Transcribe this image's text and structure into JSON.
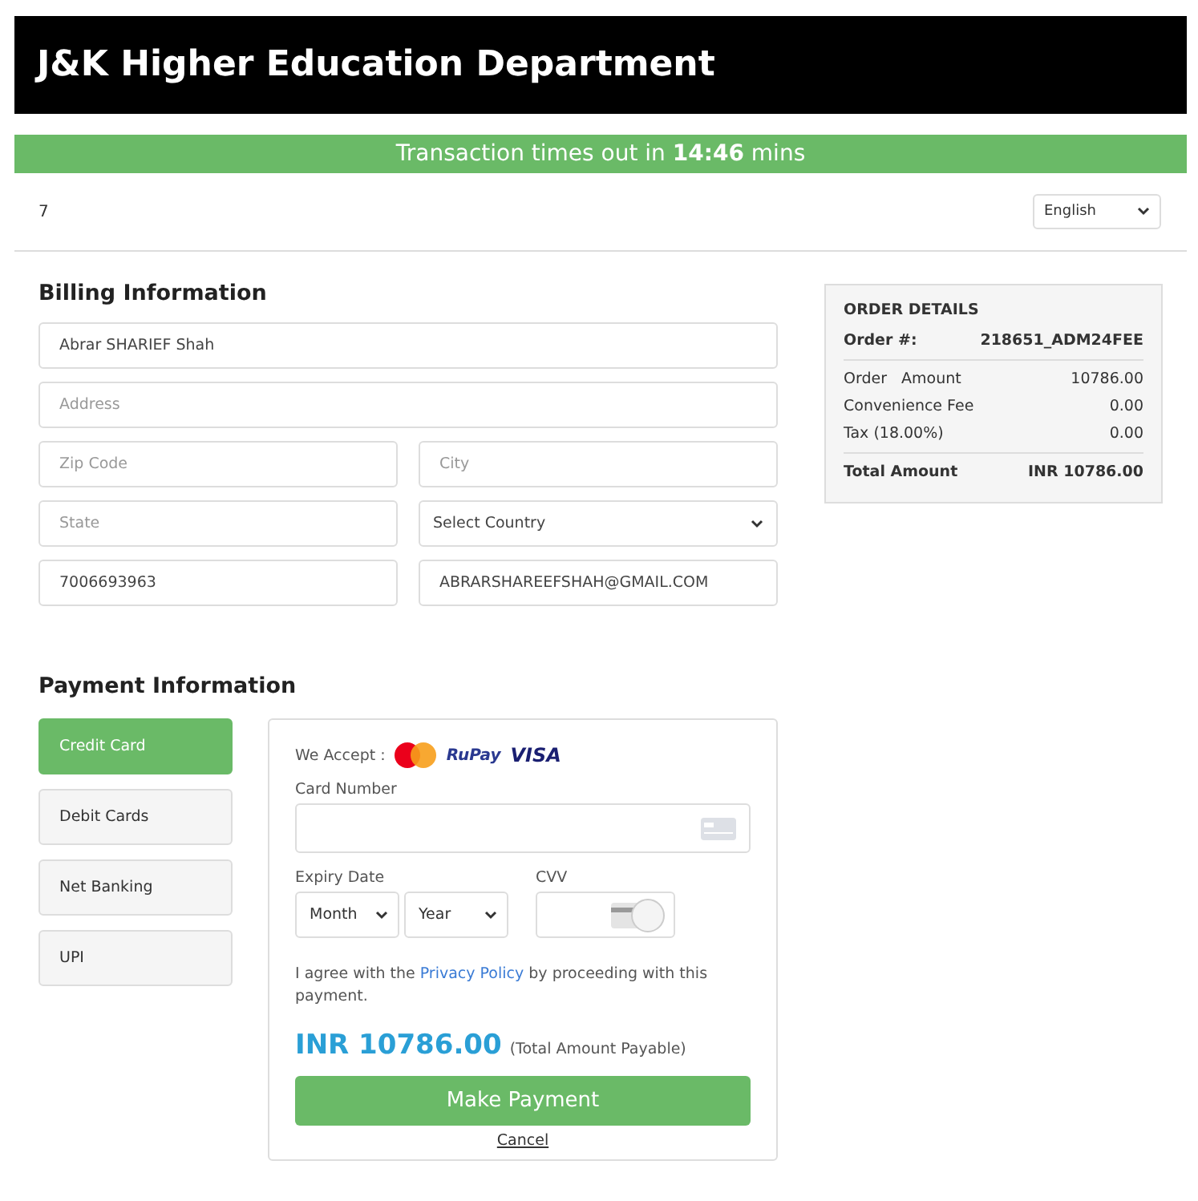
{
  "header": {
    "title": "J&K Higher Education Department"
  },
  "timeout_bar": {
    "text": "Transaction times out in **14:46** mins"
  },
  "top_row": {
    "reference": "7",
    "language": "English"
  },
  "billing": {
    "heading": "Billing Information",
    "fields": [
      {
        "kind": "input",
        "value": "Abrar SHARIEF Shah",
        "wide": true
      },
      {
        "kind": "input",
        "placeholder": "Address",
        "wide": true
      },
      {
        "kind": "input",
        "placeholder": "Zip Code",
        "wide": false
      },
      {
        "kind": "input",
        "placeholder": "City",
        "wide": false
      },
      {
        "kind": "input",
        "placeholder": "State",
        "wide": false
      },
      {
        "kind": "select",
        "value": "Select Country",
        "wide": false
      },
      {
        "kind": "input",
        "value": "7006693963",
        "wide": false
      },
      {
        "kind": "input",
        "value": "ABRARSHAREEFSHAH@GMAIL.COM",
        "wide": false
      }
    ]
  },
  "order_details": {
    "title": "ORDER DETAILS",
    "order_label": "Order #:",
    "order_value": "218651_ADM24FEE",
    "rows": [
      {
        "label": "Order   Amount",
        "value": "10786.00"
      },
      {
        "label": "Convenience Fee",
        "value": "0.00"
      },
      {
        "label": "Tax (18.00%)",
        "value": "0.00"
      }
    ],
    "total_label": "Total Amount",
    "total_value": "INR 10786.00"
  },
  "payment": {
    "heading": "Payment Information",
    "methods": [
      {
        "label": "Credit Card",
        "selected": true
      },
      {
        "label": "Debit Cards",
        "selected": false
      },
      {
        "label": "Net Banking",
        "selected": false
      },
      {
        "label": "UPI",
        "selected": false
      }
    ],
    "accept_label": "We Accept :",
    "brands": [
      "RuPay",
      "VISA"
    ],
    "card_number_label": "Card Number",
    "expiry_label": "Expiry Date",
    "month": "Month",
    "year": "Year",
    "cvv_label": "CVV",
    "agreement_before": "I agree with the",
    "agreement_link": "Privacy Policy",
    "agreement_after": "by proceeding with this payment.",
    "amount": "INR 10786.00",
    "amount_note": "(Total Amount Payable)",
    "pay_button": "Make Payment",
    "cancel": "Cancel"
  }
}
